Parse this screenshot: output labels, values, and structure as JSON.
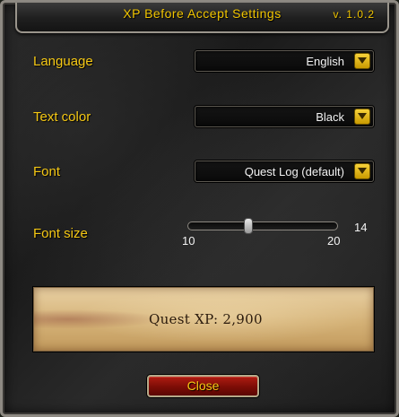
{
  "window": {
    "title": "XP Before Accept Settings",
    "version": "v. 1.0.2"
  },
  "settings": {
    "language": {
      "label": "Language",
      "value": "English"
    },
    "text_color": {
      "label": "Text color",
      "value": "Black"
    },
    "font": {
      "label": "Font",
      "value": "Quest Log (default)"
    },
    "font_size": {
      "label": "Font size",
      "min": "10",
      "max": "20",
      "value": "14",
      "level": 0.4
    }
  },
  "preview": {
    "text": "Quest XP: 2,900"
  },
  "buttons": {
    "close": "Close"
  },
  "colors": {
    "label_gold": "#f5c814",
    "dropdown_arrow": "#f0c400",
    "close_button_red": "#8a0f08",
    "parchment": "#d9b77c"
  },
  "icons": {
    "dropdown_arrow": "chevron-down-icon"
  }
}
